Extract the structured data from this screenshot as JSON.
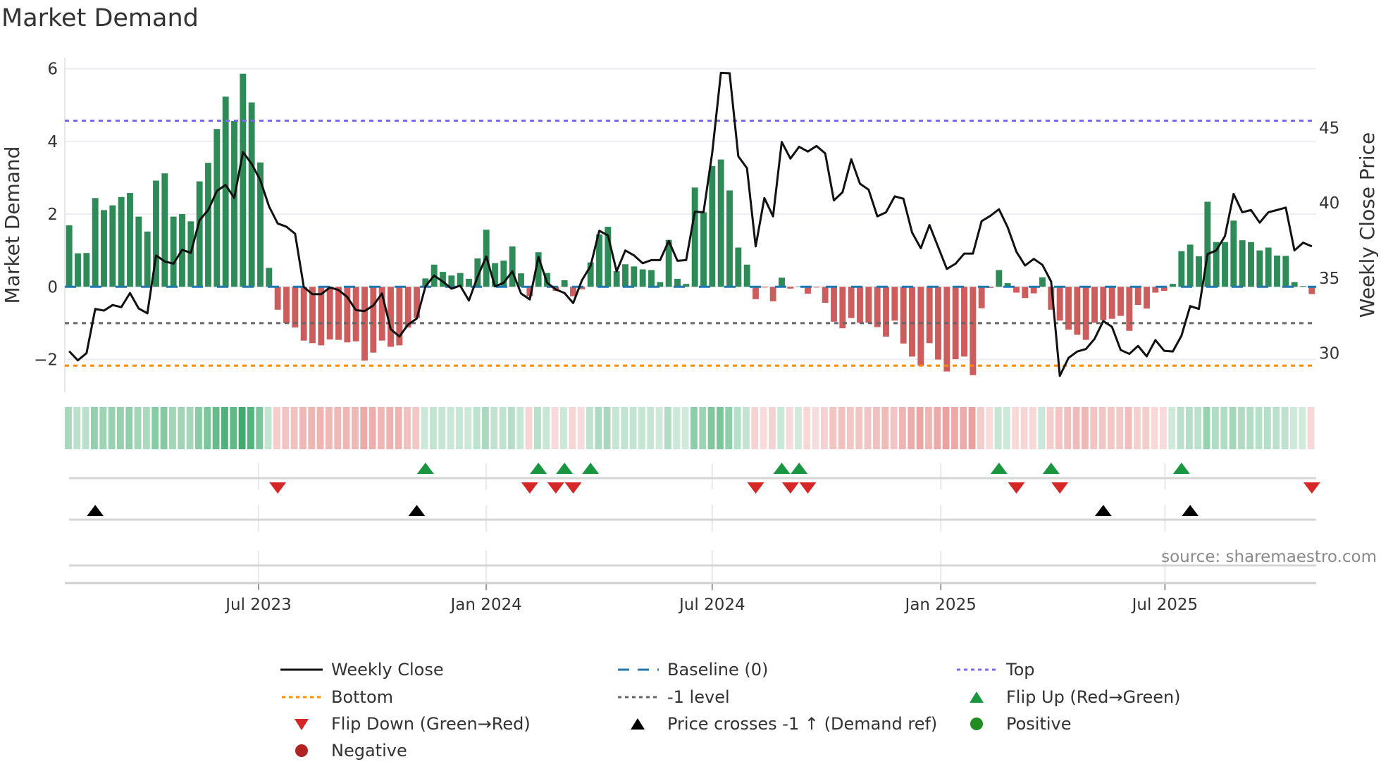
{
  "title": "Market Demand",
  "source": "source: sharemaestro.com",
  "colors": {
    "positive_bar": "#2e8b57",
    "negative_bar": "#cd5c5c",
    "line": "#111111",
    "baseline": "#1f77b4",
    "top": "#7b68ee",
    "bottom": "#ff8c00",
    "minus1": "#666666",
    "flip_up": "#1a9641",
    "flip_down": "#d62728",
    "cross": "#000000",
    "positive_dot": "#228b22",
    "negative_dot": "#b22222",
    "heat_green": "#2ca25f",
    "heat_red": "#d9534f"
  },
  "chart_data": {
    "type": "bar+line",
    "title": "Market Demand",
    "frequency": "weekly",
    "start_date": "2023-01-30",
    "ylabel": "Market Demand",
    "y2label": "Weekly Close Price",
    "ylim": [
      -2.9,
      6.3
    ],
    "y2lim": [
      27.4,
      49.65
    ],
    "yticks": [
      -2,
      0,
      2,
      4,
      6
    ],
    "ytick_labels": [
      "−2",
      "0",
      "2",
      "4",
      "6"
    ],
    "y2ticks": [
      30,
      35,
      40,
      45
    ],
    "y2tick_labels": [
      "30",
      "35",
      "40",
      "45"
    ],
    "xticks": [
      {
        "label": "Jul 2023",
        "week_index": 21.8
      },
      {
        "label": "Jan 2024",
        "week_index": 48.0
      },
      {
        "label": "Jul 2024",
        "week_index": 74.0
      },
      {
        "label": "Jan 2025",
        "week_index": 100.3
      },
      {
        "label": "Jul 2025",
        "week_index": 126.1
      }
    ],
    "levels": {
      "baseline": 0,
      "top": 4.57,
      "bottom": -2.17,
      "minus1": -1
    },
    "demand": [
      1.69,
      0.92,
      0.93,
      2.44,
      2.11,
      2.24,
      2.47,
      2.58,
      1.93,
      1.52,
      2.92,
      3.12,
      1.93,
      2.0,
      1.8,
      2.9,
      3.41,
      4.34,
      5.23,
      4.56,
      5.86,
      5.07,
      3.42,
      0.52,
      -0.63,
      -1.0,
      -1.12,
      -1.48,
      -1.55,
      -1.61,
      -1.45,
      -1.46,
      -1.53,
      -1.5,
      -2.03,
      -1.81,
      -1.48,
      -1.65,
      -1.61,
      -1.12,
      -0.86,
      0.23,
      0.61,
      0.41,
      0.31,
      0.38,
      0.22,
      0.78,
      1.57,
      0.65,
      0.72,
      1.11,
      0.37,
      -0.26,
      0.95,
      0.38,
      -0.11,
      0.18,
      -0.26,
      -0.07,
      0.67,
      1.44,
      1.65,
      0.43,
      0.62,
      0.56,
      0.48,
      0.46,
      0.13,
      1.29,
      0.22,
      0.08,
      2.73,
      2.05,
      3.32,
      3.5,
      2.65,
      1.08,
      0.61,
      -0.34,
      -0.02,
      -0.4,
      0.25,
      -0.05,
      0.01,
      -0.19,
      -0.02,
      -0.44,
      -0.96,
      -1.14,
      -0.86,
      -0.99,
      -0.99,
      -1.11,
      -1.37,
      -0.93,
      -1.56,
      -1.92,
      -2.17,
      -1.55,
      -2.0,
      -2.33,
      -1.99,
      -1.92,
      -2.43,
      -0.59,
      -0.03,
      0.46,
      0.1,
      -0.16,
      -0.31,
      -0.18,
      0.26,
      -0.63,
      -0.93,
      -1.18,
      -1.32,
      -1.46,
      -0.99,
      -0.92,
      -0.88,
      -0.8,
      -1.21,
      -0.5,
      -0.6,
      -0.16,
      -0.11,
      0.08,
      0.98,
      1.16,
      0.84,
      2.34,
      1.23,
      1.23,
      1.82,
      1.28,
      1.23,
      1.0,
      1.08,
      0.86,
      0.85,
      0.13,
      0.02,
      -0.2
    ],
    "weekly_close": [
      30.13,
      29.52,
      30.0,
      32.94,
      32.83,
      33.2,
      33.06,
      34.0,
      32.97,
      32.65,
      36.5,
      36.1,
      35.95,
      36.87,
      36.67,
      38.84,
      39.52,
      40.79,
      41.19,
      40.32,
      43.38,
      42.59,
      41.5,
      39.76,
      38.62,
      38.41,
      37.94,
      34.4,
      33.92,
      33.92,
      34.37,
      34.2,
      33.73,
      32.86,
      32.8,
      33.17,
      33.97,
      31.6,
      31.1,
      31.9,
      32.3,
      34.44,
      35.16,
      34.76,
      34.29,
      34.49,
      33.5,
      35.08,
      36.43,
      34.44,
      34.68,
      35.44,
      33.97,
      33.57,
      36.4,
      34.68,
      34.24,
      34.0,
      33.33,
      34.84,
      35.8,
      38.14,
      37.83,
      35.44,
      36.83,
      36.5,
      35.98,
      36.19,
      36.19,
      37.46,
      36.14,
      36.19,
      39.41,
      39.37,
      43.33,
      48.65,
      48.62,
      43.1,
      42.3,
      37.1,
      40.32,
      39.1,
      44.05,
      42.94,
      43.73,
      43.41,
      43.78,
      43.29,
      40.16,
      40.71,
      42.9,
      41.27,
      40.87,
      39.1,
      39.37,
      40.43,
      40.27,
      38.02,
      36.98,
      38.52,
      37.06,
      35.6,
      35.95,
      36.62,
      36.62,
      38.78,
      39.13,
      39.57,
      38.37,
      36.75,
      35.83,
      36.27,
      35.87,
      34.76,
      28.49,
      29.68,
      30.11,
      30.27,
      30.95,
      32.14,
      31.75,
      30.21,
      29.95,
      30.48,
      29.79,
      30.87,
      30.16,
      30.11,
      31.16,
      33.13,
      32.94,
      36.59,
      36.83,
      37.78,
      40.59,
      39.37,
      39.52,
      38.68,
      39.37,
      39.52,
      39.68,
      36.83,
      37.35,
      37.1
    ],
    "flip_up_week_index": [
      41,
      54,
      57,
      60,
      82,
      84,
      107,
      113,
      128
    ],
    "flip_down_week_index": [
      24,
      53,
      56,
      58,
      79,
      83,
      85,
      109,
      114,
      143
    ],
    "price_cross_week_index": [
      3,
      40,
      119,
      129
    ],
    "legend": {
      "placement": "bottom",
      "entries": [
        {
          "label": "Weekly Close",
          "symbol": "line"
        },
        {
          "label": "Baseline (0)",
          "symbol": "dash"
        },
        {
          "label": "Top",
          "symbol": "dot-top"
        },
        {
          "label": "Bottom",
          "symbol": "dot-bottom"
        },
        {
          "label": "-1 level",
          "symbol": "dot-minus1"
        },
        {
          "label": "Flip Up (Red→Green)",
          "symbol": "tri-up-green"
        },
        {
          "label": "Flip Down (Green→Red)",
          "symbol": "tri-down-red"
        },
        {
          "label": "Price crosses -1 ↑ (Demand ref)",
          "symbol": "tri-up-black"
        },
        {
          "label": "Positive",
          "symbol": "dot-green"
        },
        {
          "label": "Negative",
          "symbol": "dot-red"
        }
      ]
    }
  }
}
